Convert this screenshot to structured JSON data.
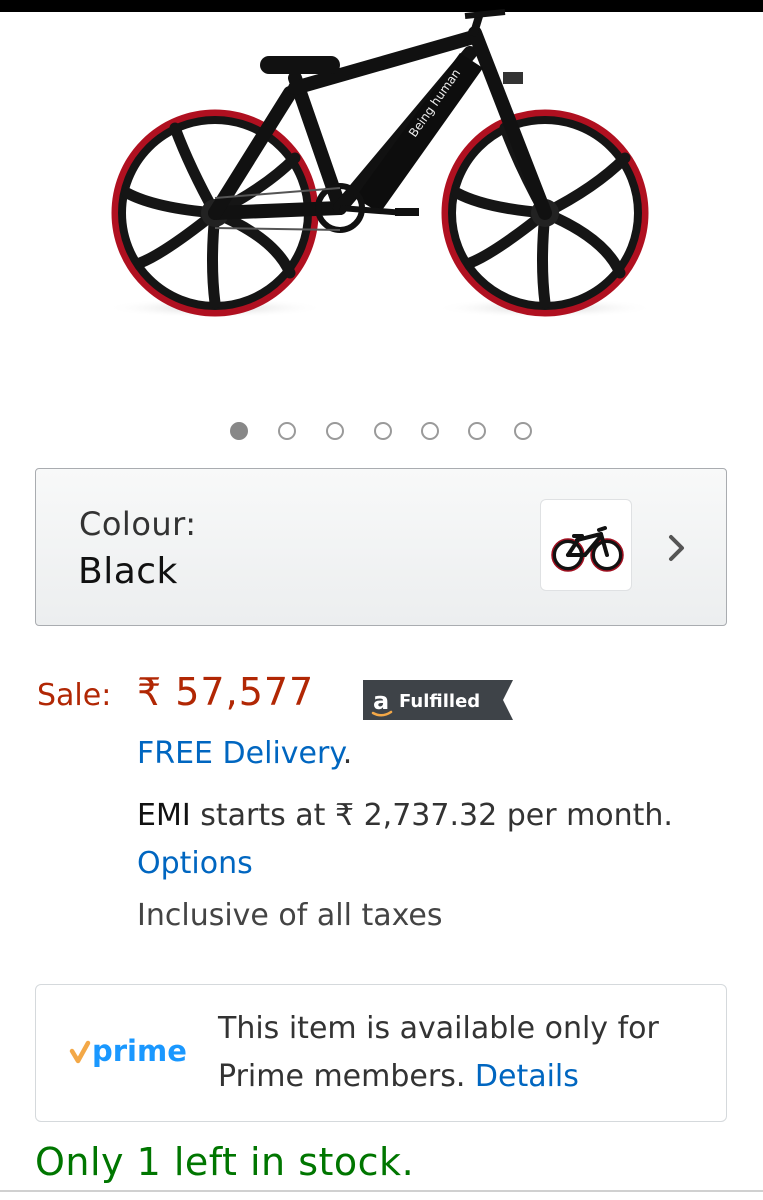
{
  "product": {
    "image_icon": "bicycle-image"
  },
  "carousel": {
    "total": 7,
    "active_index": 0
  },
  "variant": {
    "label": "Colour:",
    "value": "Black",
    "swatch_icon": "bicycle-icon",
    "chevron_icon": "chevron-right-icon"
  },
  "pricing": {
    "sale_label": "Sale:",
    "sale_price": "₹ 57,577",
    "fulfilled_badge": "Fulfilled",
    "free_delivery": "FREE Delivery",
    "free_delivery_suffix": ".",
    "emi_word": "EMI",
    "emi_middle": " starts at ₹ 2,737.32 per month. ",
    "emi_link": "Options",
    "taxes": "Inclusive of all taxes"
  },
  "prime": {
    "logo_text": "prime",
    "message": "This item is available only for Prime members. ",
    "details_link": "Details"
  },
  "stock": {
    "text": "Only 1 left in stock."
  },
  "colors": {
    "price_red": "#b12704",
    "link_blue": "#0066c0",
    "stock_green": "#007600",
    "prime_blue": "#1a98ff",
    "prime_check": "#f3a847",
    "badge_dark": "#3e4348"
  }
}
